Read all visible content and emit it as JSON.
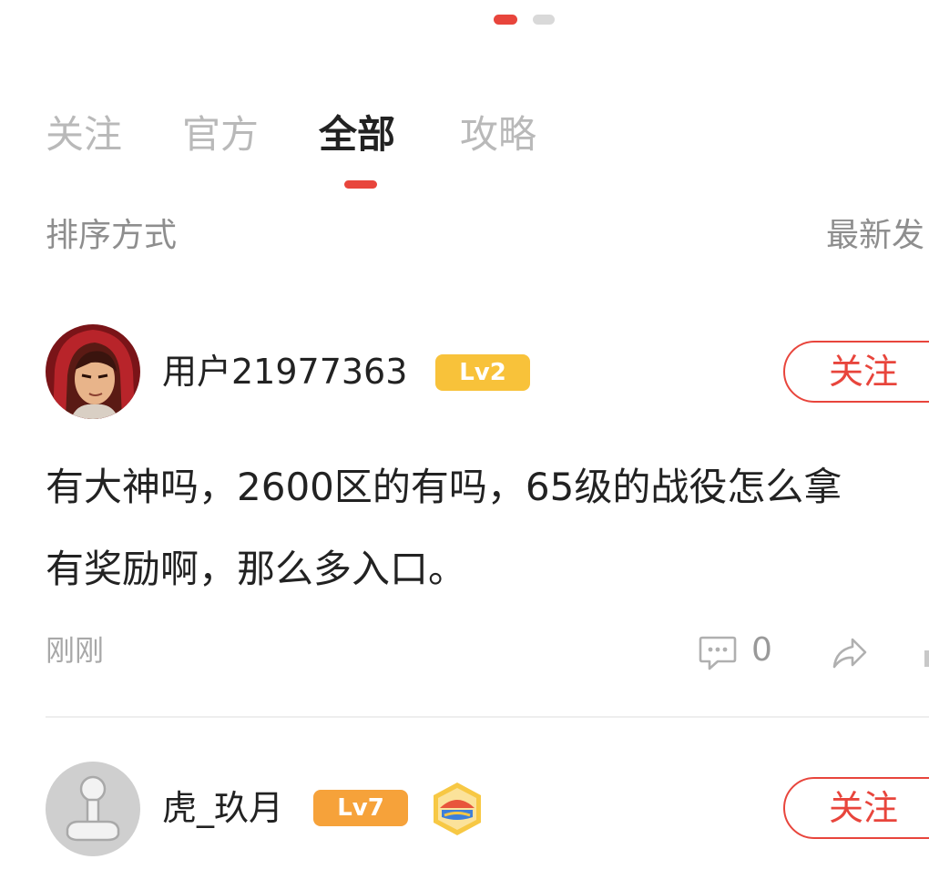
{
  "pager": {
    "total": 2,
    "active_index": 0
  },
  "tabs": [
    {
      "label": "关注",
      "active": false
    },
    {
      "label": "官方",
      "active": false
    },
    {
      "label": "全部",
      "active": true
    },
    {
      "label": "攻略",
      "active": false
    }
  ],
  "sort": {
    "label": "排序方式",
    "value": "最新发"
  },
  "posts": [
    {
      "username": "用户21977363",
      "level": "Lv2",
      "level_color": "#f8c23a",
      "follow_label": "关注",
      "content_lines": [
        "有大神吗，2600区的有吗，65级的战役怎么拿",
        "有奖励啊，那么多入口。"
      ],
      "time": "刚刚",
      "comment_count": "0",
      "avatar_icon": "avatar-red-hood-character"
    },
    {
      "username": "虎_玖月",
      "level": "Lv7",
      "level_color": "#f6a23a",
      "follow_label": "关注",
      "avatar_icon": "avatar-default-joystick",
      "badge_icon": "medal-icon"
    }
  ],
  "colors": {
    "accent": "#e8453c",
    "muted_text": "#8e8e8e",
    "tab_inactive": "#b9b9b9"
  }
}
